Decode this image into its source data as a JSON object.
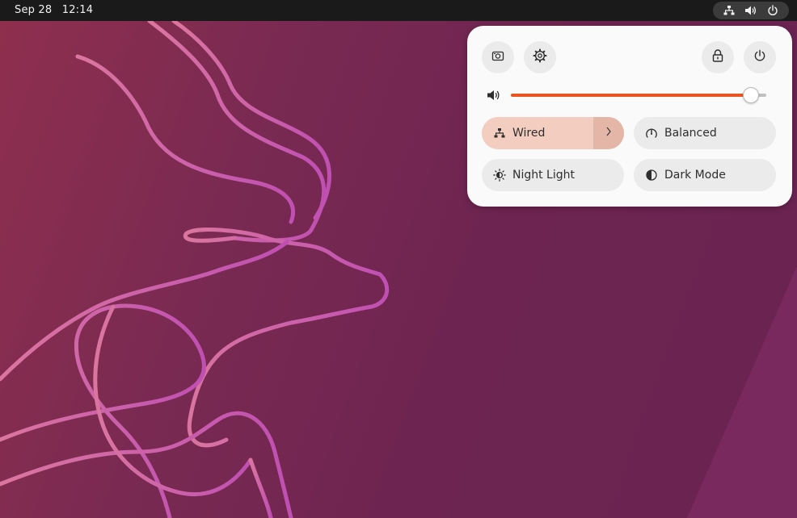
{
  "topbar": {
    "date": "Sep 28",
    "time": "12:14",
    "indicators": [
      "network-wired-icon",
      "volume-icon",
      "power-icon"
    ]
  },
  "quick_settings": {
    "buttons": [
      "screenshot-icon",
      "settings-icon",
      "lock-icon",
      "power-icon"
    ],
    "volume": {
      "level": 0.94,
      "icon": "volume-icon"
    },
    "toggles": {
      "wired": {
        "label": "Wired",
        "icon": "network-wired-icon",
        "active": true
      },
      "power_mode": {
        "label": "Balanced",
        "icon": "power-mode-icon"
      },
      "night_light": {
        "label": "Night Light",
        "icon": "night-light-icon"
      },
      "dark_mode": {
        "label": "Dark Mode",
        "icon": "dark-mode-icon"
      }
    }
  },
  "colors": {
    "accent": "#e95420",
    "toggle_active": "#f3cdc0",
    "panel_bg": "#fafafa",
    "topbar_bg": "#1a1a1a"
  }
}
